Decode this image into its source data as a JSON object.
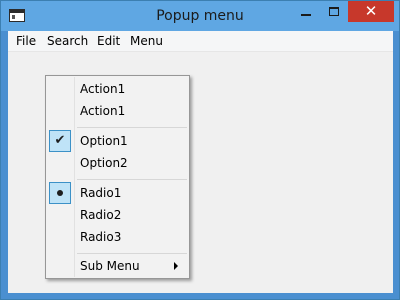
{
  "window": {
    "title": "Popup menu"
  },
  "menubar": {
    "items": [
      "File",
      "Search",
      "Edit",
      "Menu"
    ]
  },
  "popup": {
    "action1": "Action1",
    "action2": "Action1",
    "option1": "Option1",
    "option1_checked": true,
    "option2": "Option2",
    "radio1": "Radio1",
    "radio1_selected": true,
    "radio2": "Radio2",
    "radio3": "Radio3",
    "submenu": "Sub Menu"
  },
  "colors": {
    "titlebar": "#5fa7e3",
    "close_button": "#c7382b",
    "check_highlight": "#bfe3f7"
  }
}
